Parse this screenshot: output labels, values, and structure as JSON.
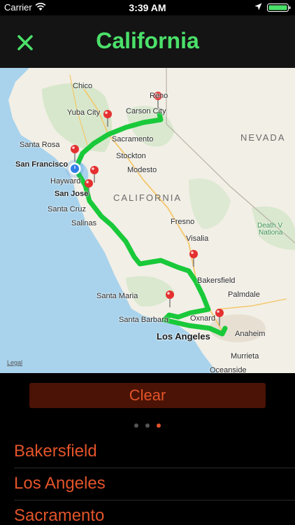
{
  "status_bar": {
    "carrier": "Carrier",
    "time": "3:39 AM"
  },
  "nav": {
    "title": "California",
    "close_icon": "close-x-icon",
    "accent_color": "#4be06a"
  },
  "map": {
    "labels": {
      "reno": "Reno",
      "chico": "Chico",
      "yuba_city": "Yuba City",
      "carson_city": "Carson City",
      "santa_rosa": "Santa Rosa",
      "sacramento": "Sacramento",
      "nevada": "NEVADA",
      "san_francisco": "San Francisco",
      "stockton": "Stockton",
      "modesto": "Modesto",
      "hayward": "Hayward",
      "san_jose": "San Jose",
      "california": "CALIFORNIA",
      "santa_cruz": "Santa Cruz",
      "salinas": "Salinas",
      "fresno": "Fresno",
      "death_valley": "Death V",
      "national": "Nationa",
      "visalia": "Visalia",
      "bakersfield": "Bakersfield",
      "santa_maria": "Santa Maria",
      "palmdale": "Palmdale",
      "santa_barbara": "Santa Barbara",
      "oxnard": "Oxnard",
      "anaheim": "Anaheim",
      "los_angeles": "Los Angeles",
      "murrieta": "Murrieta",
      "oceanside": "Oceanside"
    },
    "legal": "Legal",
    "route_color": "#19c93a",
    "pin_color": "#e53030"
  },
  "controls": {
    "clear_label": "Clear",
    "page_count": 3,
    "active_page": 3,
    "accent_color": "#e2542a"
  },
  "list": {
    "items": [
      {
        "label": "Bakersfield"
      },
      {
        "label": "Los Angeles"
      },
      {
        "label": "Sacramento"
      }
    ]
  }
}
